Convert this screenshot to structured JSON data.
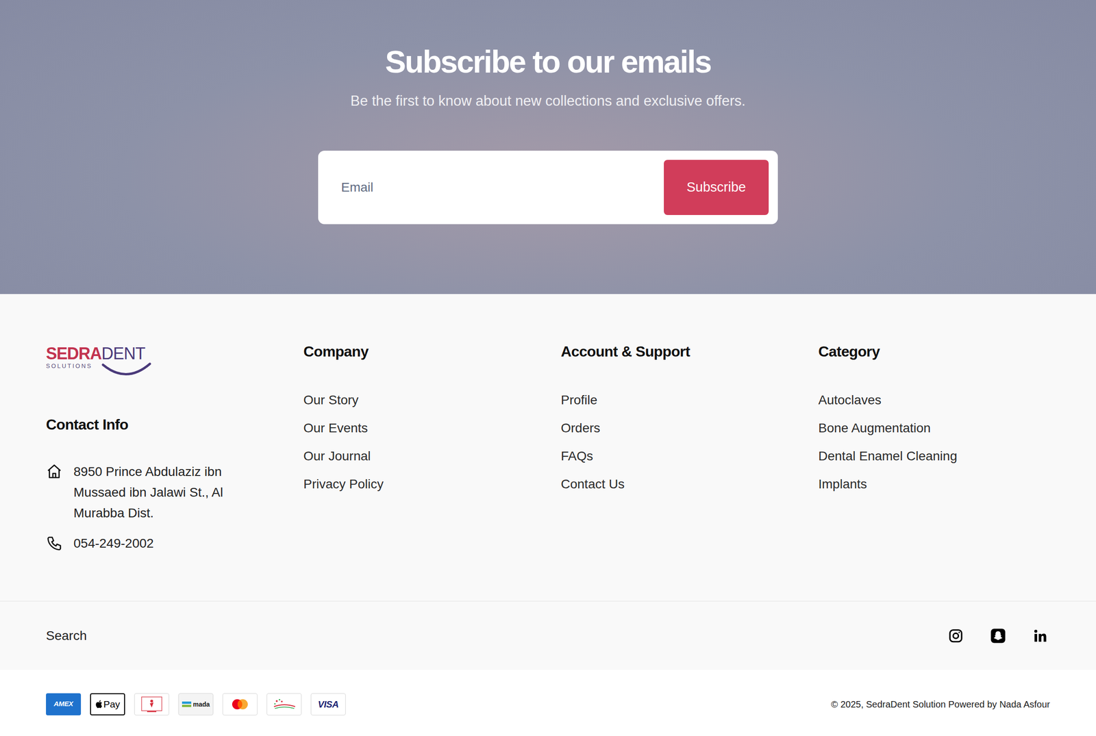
{
  "subscribe": {
    "title": "Subscribe to our emails",
    "subtitle": "Be the first to know about new collections and exclusive offers.",
    "email_placeholder": "Email",
    "button": "Subscribe"
  },
  "logo": {
    "part1": "SEDRA",
    "part2": "DENT",
    "tagline": "SOLUTIONS"
  },
  "contact": {
    "heading": "Contact Info",
    "address": "8950 Prince Abdulaziz ibn Mussaed ibn Jalawi St., Al Murabba Dist.",
    "phone": "054-249-2002"
  },
  "columns": [
    {
      "heading": "Company",
      "links": [
        "Our Story",
        "Our Events",
        "Our Journal",
        "Privacy Policy"
      ]
    },
    {
      "heading": "Account & Support",
      "links": [
        "Profile",
        "Orders",
        "FAQs",
        "Contact Us"
      ]
    },
    {
      "heading": "Category",
      "links": [
        "Autoclaves",
        "Bone Augmentation",
        "Dental Enamel Cleaning",
        "Implants"
      ]
    }
  ],
  "search": "Search",
  "payments": [
    {
      "kind": "amex",
      "label": "AMEX"
    },
    {
      "kind": "applepay",
      "label": "Pay"
    },
    {
      "kind": "benefit"
    },
    {
      "kind": "mada",
      "label": "mada"
    },
    {
      "kind": "mastercard"
    },
    {
      "kind": "marinet"
    },
    {
      "kind": "visa",
      "label": "VISA"
    }
  ],
  "copyright": "© 2025, SedraDent Solution Powered by Nada Asfour"
}
